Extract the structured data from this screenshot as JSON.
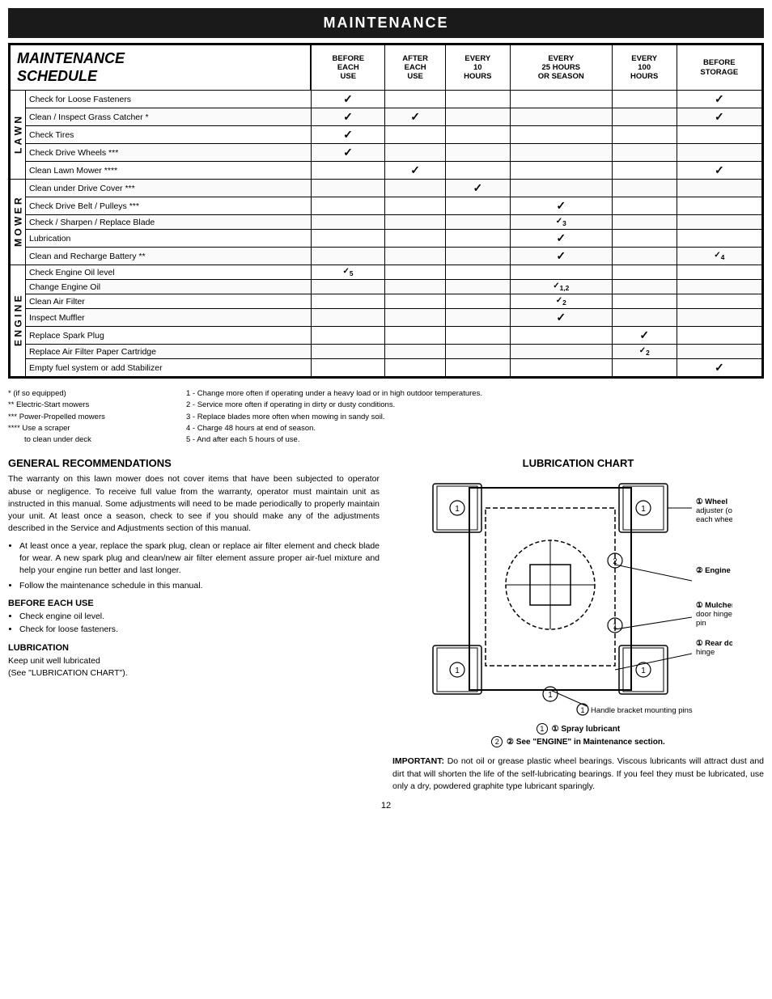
{
  "page": {
    "title": "MAINTENANCE",
    "page_number": "12"
  },
  "maintenance_schedule": {
    "title_line1": "MAINTENANCE",
    "title_line2": "SCHEDULE",
    "columns": [
      {
        "id": "before_each_use",
        "label": "BEFORE\nEACH\nUSE"
      },
      {
        "id": "after_each_use",
        "label": "AFTER\nEACH\nUSE"
      },
      {
        "id": "every_10_hours",
        "label": "EVERY\n10\nHOURS"
      },
      {
        "id": "every_25_hours",
        "label": "EVERY\n25 HOURS\nOR SEASON"
      },
      {
        "id": "every_100_hours",
        "label": "EVERY\n100\nHOURS"
      },
      {
        "id": "before_storage",
        "label": "BEFORE\nSTORAGE"
      }
    ],
    "sections": [
      {
        "label": "L\nA\nW\nN",
        "rows": [
          {
            "task": "Check for Loose Fasteners",
            "checks": {
              "before_each_use": "✓",
              "before_storage": "✓"
            }
          },
          {
            "task": "Clean / Inspect Grass Catcher *",
            "checks": {
              "before_each_use": "✓",
              "after_each_use": "✓",
              "before_storage": "✓"
            }
          },
          {
            "task": "Check Tires",
            "checks": {
              "before_each_use": "✓"
            }
          },
          {
            "task": "Check Drive Wheels ***",
            "checks": {
              "before_each_use": "✓"
            }
          },
          {
            "task": "Clean Lawn Mower ****",
            "checks": {
              "after_each_use": "✓",
              "before_storage": "✓"
            }
          }
        ]
      },
      {
        "label": "M\nO\nW\nE\nR",
        "rows": [
          {
            "task": "Clean under Drive Cover ***",
            "checks": {
              "every_10_hours": "✓"
            }
          },
          {
            "task": "Check Drive Belt / Pulleys ***",
            "checks": {
              "every_25_hours": "✓"
            }
          },
          {
            "task": "Check / Sharpen / Replace Blade",
            "checks": {
              "every_25_hours": "✓₃"
            }
          },
          {
            "task": "Lubrication",
            "checks": {
              "every_25_hours": "✓"
            }
          },
          {
            "task": "Clean and Recharge Battery **",
            "checks": {
              "every_25_hours": "✓",
              "before_storage": "✓₄"
            }
          }
        ]
      },
      {
        "label": "E\nN\nG\nI\nN\nE",
        "rows": [
          {
            "task": "Check Engine Oil level",
            "checks": {
              "before_each_use": "✓₅"
            }
          },
          {
            "task": "Change Engine Oil",
            "checks": {
              "every_25_hours": "✓₁,₂"
            }
          },
          {
            "task": "Clean Air Filter",
            "checks": {
              "every_25_hours": "✓₂"
            }
          },
          {
            "task": "Inspect Muffler",
            "checks": {
              "every_25_hours": "✓"
            }
          },
          {
            "task": "Replace Spark Plug",
            "checks": {
              "every_100_hours": "✓"
            }
          },
          {
            "task": "Replace Air Filter Paper Cartridge",
            "checks": {
              "every_100_hours": "✓₂"
            }
          },
          {
            "task": "Empty fuel system or add Stabilizer",
            "checks": {
              "before_storage": "✓"
            }
          }
        ]
      }
    ]
  },
  "footnotes": {
    "left": [
      "* (if so equipped)",
      "** Electric-Start mowers",
      "*** Power-Propelled mowers",
      "**** Use a scraper",
      "     to clean under deck"
    ],
    "right": [
      "1 - Change more often if operating under a heavy load or in high outdoor temperatures.",
      "2 - Service more often if operating in dirty or dusty conditions.",
      "3 - Replace blades more often when mowing in sandy soil.",
      "4 - Charge 48 hours at end of season.",
      "5 - And after each 5 hours of use."
    ]
  },
  "general_recommendations": {
    "heading": "GENERAL RECOMMENDATIONS",
    "paragraph1": "The warranty on this lawn mower does not cover items that have been subjected to operator abuse or negligence.  To receive full value from the warranty, operator must maintain unit as instructed in this manual.  Some adjustments will need to be made periodically to properly maintain your unit.  At least once a season, check to see if you should make any of the adjustments described in the Service and Adjustments section of this manual.",
    "bullets": [
      "At least once a year, replace the spark plug, clean or replace air filter element and check blade for wear.  A new spark plug and clean/new air filter element assure proper air-fuel mixture and help your engine run better and last longer.",
      "Follow the maintenance schedule in this manual."
    ],
    "before_each_use_heading": "BEFORE EACH USE",
    "before_each_use_items": [
      "Check engine oil level.",
      "Check for loose fasteners."
    ],
    "lubrication_heading": "LUBRICATION",
    "lubrication_text": "Keep unit well lubricated\n(See \"LUBRICATION CHART\")."
  },
  "lubrication_chart": {
    "heading": "LUBRICATION CHART",
    "labels": [
      {
        "num": "①",
        "text": "Wheel adjuster (on each wheel)"
      },
      {
        "num": "②",
        "text": "Engine oil"
      },
      {
        "num": "①",
        "text": "Mulcher door hinge pin"
      },
      {
        "num": "①",
        "text": "Rear door hinge"
      },
      {
        "num": "①",
        "text": "Handle bracket mounting pins"
      }
    ],
    "legend_line1": "① Spray lubricant",
    "legend_line2": "② See \"ENGINE\" in Maintenance section."
  },
  "important_note": {
    "label": "IMPORTANT:",
    "text": " Do not oil or grease plastic wheel bearings.  Viscous lubricants will attract dust and dirt that will shorten the life of the self-lubricating bearings.  If you feel they must be lubricated, use only a dry, powdered graphite type lubricant sparingly."
  }
}
